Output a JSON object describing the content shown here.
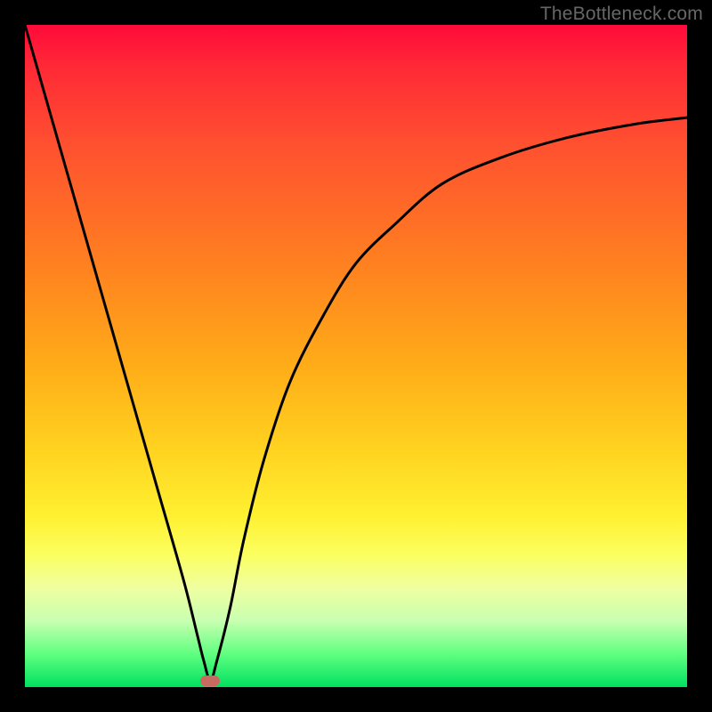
{
  "watermark": "TheBottleneck.com",
  "colors": {
    "frame": "#000000",
    "curve": "#000000",
    "marker": "#c76a60"
  },
  "chart_data": {
    "type": "line",
    "title": "",
    "xlabel": "",
    "ylabel": "",
    "xlim": [
      0,
      100
    ],
    "ylim": [
      0,
      100
    ],
    "grid": false,
    "legend": false,
    "series": [
      {
        "name": "curve",
        "x": [
          0,
          4,
          8,
          12,
          16,
          20,
          24,
          26,
          27,
          28,
          29,
          31,
          33,
          36,
          40,
          45,
          50,
          56,
          63,
          72,
          82,
          92,
          100
        ],
        "values": [
          100,
          86,
          72,
          58,
          44,
          30,
          16,
          8,
          4,
          1,
          4,
          12,
          22,
          34,
          46,
          56,
          64,
          70,
          76,
          80,
          83,
          85,
          86
        ]
      }
    ],
    "marker": {
      "x": 28,
      "y": 1
    }
  }
}
